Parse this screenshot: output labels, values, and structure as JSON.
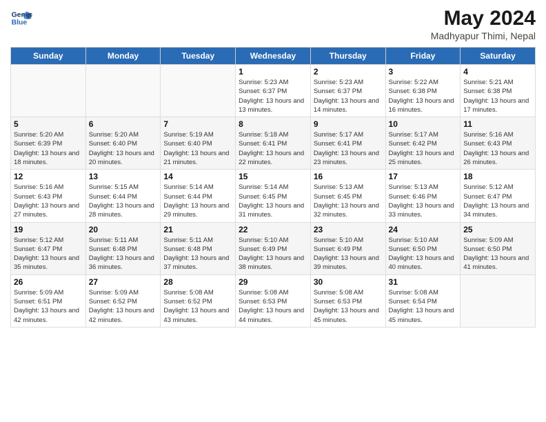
{
  "header": {
    "logo_line1": "General",
    "logo_line2": "Blue",
    "month_year": "May 2024",
    "location": "Madhyapur Thimi, Nepal"
  },
  "weekdays": [
    "Sunday",
    "Monday",
    "Tuesday",
    "Wednesday",
    "Thursday",
    "Friday",
    "Saturday"
  ],
  "weeks": [
    [
      {
        "day": "",
        "sunrise": "",
        "sunset": "",
        "daylight": ""
      },
      {
        "day": "",
        "sunrise": "",
        "sunset": "",
        "daylight": ""
      },
      {
        "day": "",
        "sunrise": "",
        "sunset": "",
        "daylight": ""
      },
      {
        "day": "1",
        "sunrise": "Sunrise: 5:23 AM",
        "sunset": "Sunset: 6:37 PM",
        "daylight": "Daylight: 13 hours and 13 minutes."
      },
      {
        "day": "2",
        "sunrise": "Sunrise: 5:23 AM",
        "sunset": "Sunset: 6:37 PM",
        "daylight": "Daylight: 13 hours and 14 minutes."
      },
      {
        "day": "3",
        "sunrise": "Sunrise: 5:22 AM",
        "sunset": "Sunset: 6:38 PM",
        "daylight": "Daylight: 13 hours and 16 minutes."
      },
      {
        "day": "4",
        "sunrise": "Sunrise: 5:21 AM",
        "sunset": "Sunset: 6:38 PM",
        "daylight": "Daylight: 13 hours and 17 minutes."
      }
    ],
    [
      {
        "day": "5",
        "sunrise": "Sunrise: 5:20 AM",
        "sunset": "Sunset: 6:39 PM",
        "daylight": "Daylight: 13 hours and 18 minutes."
      },
      {
        "day": "6",
        "sunrise": "Sunrise: 5:20 AM",
        "sunset": "Sunset: 6:40 PM",
        "daylight": "Daylight: 13 hours and 20 minutes."
      },
      {
        "day": "7",
        "sunrise": "Sunrise: 5:19 AM",
        "sunset": "Sunset: 6:40 PM",
        "daylight": "Daylight: 13 hours and 21 minutes."
      },
      {
        "day": "8",
        "sunrise": "Sunrise: 5:18 AM",
        "sunset": "Sunset: 6:41 PM",
        "daylight": "Daylight: 13 hours and 22 minutes."
      },
      {
        "day": "9",
        "sunrise": "Sunrise: 5:17 AM",
        "sunset": "Sunset: 6:41 PM",
        "daylight": "Daylight: 13 hours and 23 minutes."
      },
      {
        "day": "10",
        "sunrise": "Sunrise: 5:17 AM",
        "sunset": "Sunset: 6:42 PM",
        "daylight": "Daylight: 13 hours and 25 minutes."
      },
      {
        "day": "11",
        "sunrise": "Sunrise: 5:16 AM",
        "sunset": "Sunset: 6:43 PM",
        "daylight": "Daylight: 13 hours and 26 minutes."
      }
    ],
    [
      {
        "day": "12",
        "sunrise": "Sunrise: 5:16 AM",
        "sunset": "Sunset: 6:43 PM",
        "daylight": "Daylight: 13 hours and 27 minutes."
      },
      {
        "day": "13",
        "sunrise": "Sunrise: 5:15 AM",
        "sunset": "Sunset: 6:44 PM",
        "daylight": "Daylight: 13 hours and 28 minutes."
      },
      {
        "day": "14",
        "sunrise": "Sunrise: 5:14 AM",
        "sunset": "Sunset: 6:44 PM",
        "daylight": "Daylight: 13 hours and 29 minutes."
      },
      {
        "day": "15",
        "sunrise": "Sunrise: 5:14 AM",
        "sunset": "Sunset: 6:45 PM",
        "daylight": "Daylight: 13 hours and 31 minutes."
      },
      {
        "day": "16",
        "sunrise": "Sunrise: 5:13 AM",
        "sunset": "Sunset: 6:45 PM",
        "daylight": "Daylight: 13 hours and 32 minutes."
      },
      {
        "day": "17",
        "sunrise": "Sunrise: 5:13 AM",
        "sunset": "Sunset: 6:46 PM",
        "daylight": "Daylight: 13 hours and 33 minutes."
      },
      {
        "day": "18",
        "sunrise": "Sunrise: 5:12 AM",
        "sunset": "Sunset: 6:47 PM",
        "daylight": "Daylight: 13 hours and 34 minutes."
      }
    ],
    [
      {
        "day": "19",
        "sunrise": "Sunrise: 5:12 AM",
        "sunset": "Sunset: 6:47 PM",
        "daylight": "Daylight: 13 hours and 35 minutes."
      },
      {
        "day": "20",
        "sunrise": "Sunrise: 5:11 AM",
        "sunset": "Sunset: 6:48 PM",
        "daylight": "Daylight: 13 hours and 36 minutes."
      },
      {
        "day": "21",
        "sunrise": "Sunrise: 5:11 AM",
        "sunset": "Sunset: 6:48 PM",
        "daylight": "Daylight: 13 hours and 37 minutes."
      },
      {
        "day": "22",
        "sunrise": "Sunrise: 5:10 AM",
        "sunset": "Sunset: 6:49 PM",
        "daylight": "Daylight: 13 hours and 38 minutes."
      },
      {
        "day": "23",
        "sunrise": "Sunrise: 5:10 AM",
        "sunset": "Sunset: 6:49 PM",
        "daylight": "Daylight: 13 hours and 39 minutes."
      },
      {
        "day": "24",
        "sunrise": "Sunrise: 5:10 AM",
        "sunset": "Sunset: 6:50 PM",
        "daylight": "Daylight: 13 hours and 40 minutes."
      },
      {
        "day": "25",
        "sunrise": "Sunrise: 5:09 AM",
        "sunset": "Sunset: 6:50 PM",
        "daylight": "Daylight: 13 hours and 41 minutes."
      }
    ],
    [
      {
        "day": "26",
        "sunrise": "Sunrise: 5:09 AM",
        "sunset": "Sunset: 6:51 PM",
        "daylight": "Daylight: 13 hours and 42 minutes."
      },
      {
        "day": "27",
        "sunrise": "Sunrise: 5:09 AM",
        "sunset": "Sunset: 6:52 PM",
        "daylight": "Daylight: 13 hours and 42 minutes."
      },
      {
        "day": "28",
        "sunrise": "Sunrise: 5:08 AM",
        "sunset": "Sunset: 6:52 PM",
        "daylight": "Daylight: 13 hours and 43 minutes."
      },
      {
        "day": "29",
        "sunrise": "Sunrise: 5:08 AM",
        "sunset": "Sunset: 6:53 PM",
        "daylight": "Daylight: 13 hours and 44 minutes."
      },
      {
        "day": "30",
        "sunrise": "Sunrise: 5:08 AM",
        "sunset": "Sunset: 6:53 PM",
        "daylight": "Daylight: 13 hours and 45 minutes."
      },
      {
        "day": "31",
        "sunrise": "Sunrise: 5:08 AM",
        "sunset": "Sunset: 6:54 PM",
        "daylight": "Daylight: 13 hours and 45 minutes."
      },
      {
        "day": "",
        "sunrise": "",
        "sunset": "",
        "daylight": ""
      }
    ]
  ]
}
